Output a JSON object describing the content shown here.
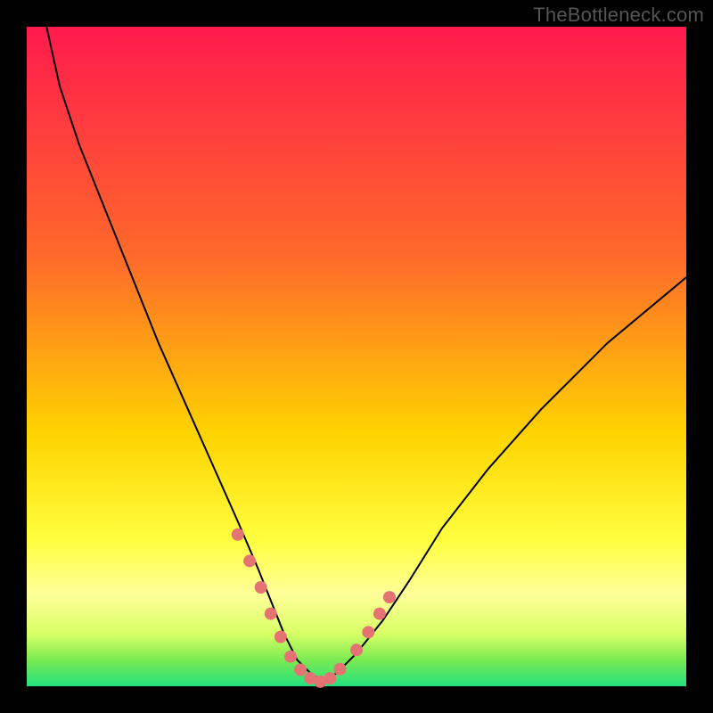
{
  "watermark": {
    "text": "TheBottleneck.com"
  },
  "chart_data": {
    "type": "line",
    "title": "",
    "xlabel": "",
    "ylabel": "",
    "x_range": [
      0,
      100
    ],
    "y_range": [
      0,
      100
    ],
    "grid": false,
    "legend": false,
    "background_gradient": {
      "direction": "vertical",
      "stops": [
        {
          "pos": 0.0,
          "color": "#ff1a4d"
        },
        {
          "pos": 0.35,
          "color": "#ff6a2a"
        },
        {
          "pos": 0.62,
          "color": "#ffd400"
        },
        {
          "pos": 0.78,
          "color": "#ffff40"
        },
        {
          "pos": 0.86,
          "color": "#ffff99"
        },
        {
          "pos": 0.92,
          "color": "#d9ff66"
        },
        {
          "pos": 0.96,
          "color": "#7bea52"
        },
        {
          "pos": 1.0,
          "color": "#23e07f"
        }
      ]
    },
    "series": [
      {
        "name": "bottleneck-curve",
        "color": "#000000",
        "x": [
          3,
          5,
          8,
          12,
          16,
          20,
          24,
          28,
          32,
          35,
          37,
          39,
          41,
          43,
          45,
          47,
          50,
          54,
          58,
          63,
          70,
          78,
          88,
          100
        ],
        "y": [
          100,
          91,
          82,
          72,
          62,
          52,
          43,
          34,
          25,
          18,
          13,
          8,
          4,
          2,
          0.7,
          2,
          5,
          10,
          16,
          24,
          33,
          42,
          52,
          62
        ]
      }
    ],
    "markers": {
      "name": "highlight-dots",
      "color": "#e57373",
      "radius_px": 7,
      "points": [
        {
          "x": 32.0,
          "y": 23
        },
        {
          "x": 33.8,
          "y": 19
        },
        {
          "x": 35.5,
          "y": 15
        },
        {
          "x": 37.0,
          "y": 11
        },
        {
          "x": 38.5,
          "y": 7.5
        },
        {
          "x": 40.0,
          "y": 4.5
        },
        {
          "x": 41.5,
          "y": 2.5
        },
        {
          "x": 43.0,
          "y": 1.2
        },
        {
          "x": 44.5,
          "y": 0.7
        },
        {
          "x": 46.0,
          "y": 1.2
        },
        {
          "x": 47.5,
          "y": 2.6
        },
        {
          "x": 50.0,
          "y": 5.5
        },
        {
          "x": 51.8,
          "y": 8.2
        },
        {
          "x": 53.5,
          "y": 11.0
        },
        {
          "x": 55.0,
          "y": 13.5
        }
      ]
    }
  }
}
